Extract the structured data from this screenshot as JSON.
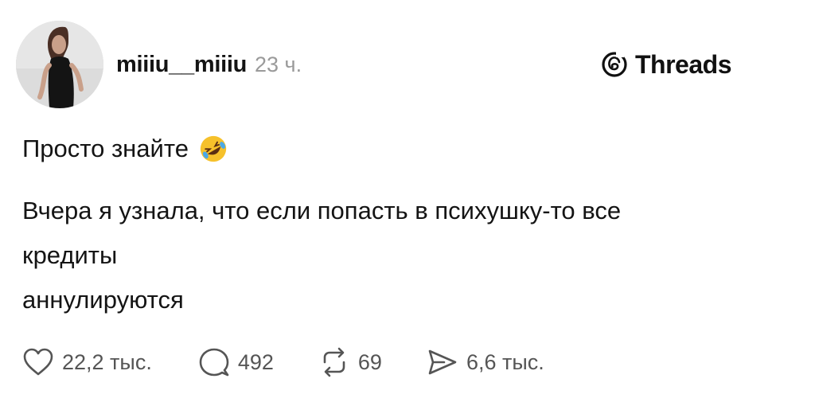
{
  "post": {
    "author": {
      "username": "miiiu__miiiu",
      "time": "23 ч."
    },
    "brand": {
      "icon": "threads-logo-icon",
      "label": "Threads"
    },
    "body": {
      "line1": "Просто знайте",
      "emoji": "rolling-on-floor-laughing-emoji",
      "line2": "Вчера я узнала, что если попасть в психушку-то все",
      "line3": "кредиты",
      "line4": "аннулируются"
    },
    "actions": {
      "likes": "22,2 тыс.",
      "replies": "492",
      "reposts": "69",
      "shares": "6,6 тыс."
    }
  },
  "colors": {
    "text": "#141414",
    "muted": "#9a9a9a",
    "action": "#555555",
    "background": "#ffffff"
  }
}
